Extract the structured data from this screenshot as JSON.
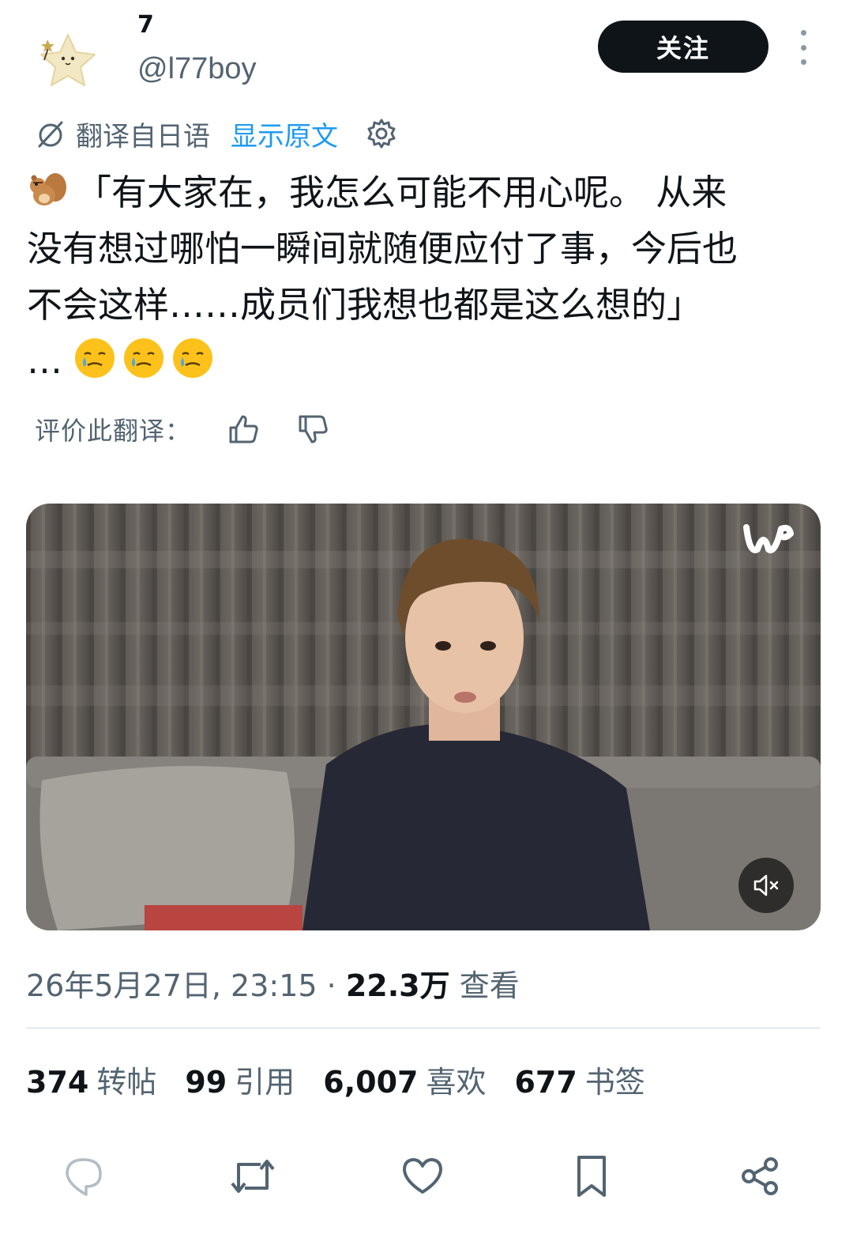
{
  "author": {
    "display_name": "7",
    "handle": "@l77boy"
  },
  "header": {
    "follow_label": "关注",
    "more_icon": "more-vertical-icon"
  },
  "translation": {
    "from_label": "翻译自日语",
    "show_original_label": "显示原文",
    "settings_icon": "gear-icon"
  },
  "tweet": {
    "lines": [
      "「有大家在，我怎么可能不用心呢。 从来",
      "没有想过哪怕一瞬间就随便应付了事，今后也",
      "不会这样……成员们我想也都是这么想的」",
      "…"
    ],
    "leading_emoji": "chipmunk-emoji",
    "trailing_emoji": "face-holding-back-tears-emoji"
  },
  "rate_translation": {
    "label": "评价此翻译："
  },
  "video": {
    "brand_logo": "weverse-logo",
    "mute_icon": "speaker-muted-icon"
  },
  "meta": {
    "date_time": "26年5月27日, 23:15",
    "separator": "·",
    "views_count": "22.3万",
    "views_label": "查看"
  },
  "stats": [
    {
      "num": "374",
      "label": "转帖"
    },
    {
      "num": "99",
      "label": "引用"
    },
    {
      "num": "6,007",
      "label": "喜欢"
    },
    {
      "num": "677",
      "label": "书签"
    }
  ],
  "actions": [
    "reply-icon",
    "repost-icon",
    "like-icon",
    "bookmark-icon",
    "share-icon"
  ],
  "colors": {
    "accent": "#1d9bf0",
    "text": "#0f1419",
    "secondary": "#536471",
    "follow_bg": "#0f1419"
  }
}
